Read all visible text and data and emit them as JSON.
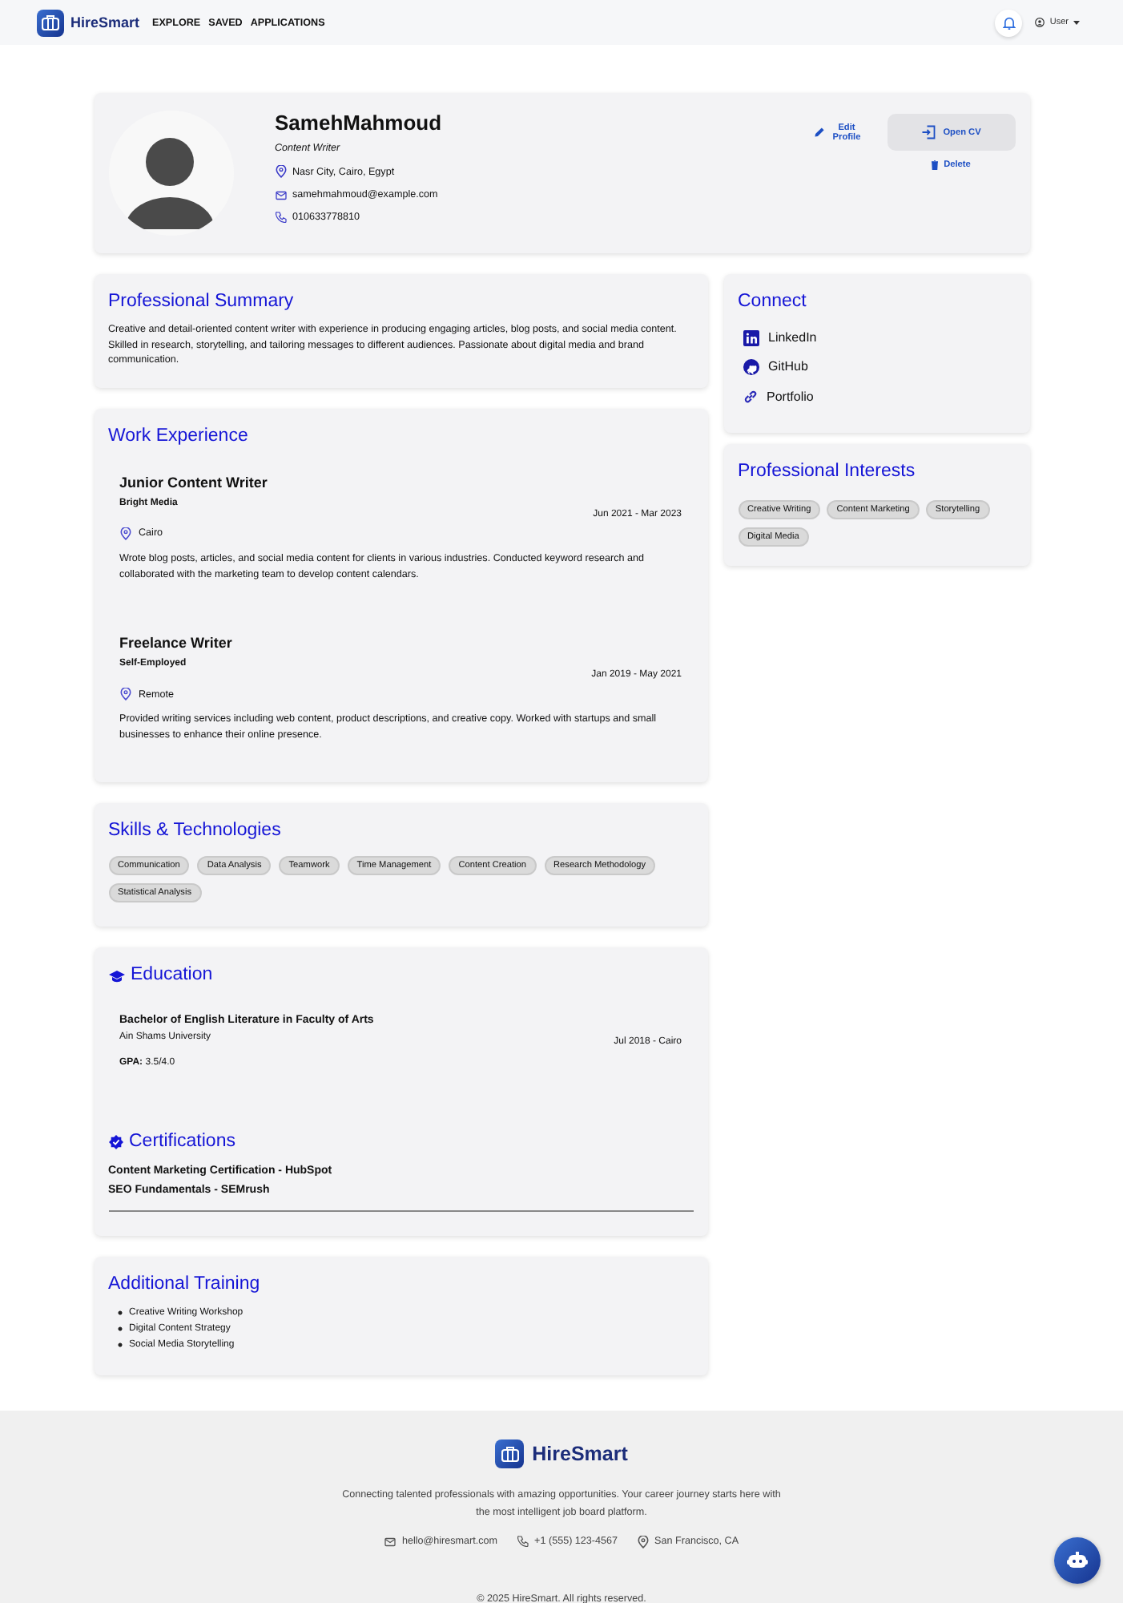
{
  "nav": {
    "brand": "HireSmart",
    "links": [
      "EXPLORE",
      "SAVED",
      "APPLICATIONS"
    ],
    "user": "User"
  },
  "profile": {
    "name": "SamehMahmoud",
    "title": "Content Writer",
    "location": "Nasr City, Cairo, Egypt",
    "email": "samehmahmoud@example.com",
    "phone": "010633778810",
    "actions": [
      {
        "label": "Edit Profile",
        "kind": "edit"
      },
      {
        "label": "Open CV",
        "kind": "open"
      },
      {
        "label": "Delete",
        "kind": "delete"
      }
    ]
  },
  "summary": {
    "title": "Professional Summary",
    "text": "Creative and detail-oriented content writer with experience in producing engaging articles, blog posts, and social media content. Skilled in research, storytelling, and tailoring messages to different audiences. Passionate about digital media and brand communication."
  },
  "experience": {
    "title": "Work Experience",
    "jobs": [
      {
        "role": "Junior Content Writer",
        "company": "Bright Media",
        "dates": "Jun 2021 - Mar 2023",
        "location": "Cairo",
        "description": "Wrote blog posts, articles, and social media content for clients in various industries. Conducted keyword research and collaborated with the marketing team to develop content calendars."
      },
      {
        "role": "Freelance Writer",
        "company": "Self-Employed",
        "dates": "Jan 2019 - May 2021",
        "location": "Remote",
        "description": "Provided writing services including web content, product descriptions, and creative copy. Worked with startups and small businesses to enhance their online presence."
      }
    ]
  },
  "skills": {
    "title": "Skills & Technologies",
    "tags": [
      "Communication",
      "Data Analysis",
      "Teamwork",
      "Time Management",
      "Content Creation",
      "Research Methodology",
      "Statistical Analysis"
    ]
  },
  "education": {
    "title": "Education",
    "entries": [
      {
        "degree": "Bachelor of English Literature in Faculty of Arts",
        "school": "Ain Shams University",
        "date": "Jul 2018 - Cairo",
        "gpa": "**GPA:** 3.5/4.0"
      }
    ]
  },
  "certifications": {
    "title": "Certifications",
    "items": [
      "Content Marketing Certification - HubSpot",
      "SEO Fundamentals - SEMrush"
    ]
  },
  "training": {
    "title": "Additional Training",
    "items": [
      "Creative Writing Workshop",
      "Digital Content Strategy",
      "Social Media Storytelling"
    ]
  },
  "connect": {
    "title": "Connect",
    "links": [
      {
        "label": "LinkedIn",
        "kind": "linkedin"
      },
      {
        "label": "GitHub",
        "kind": "github"
      },
      {
        "label": "Portfolio",
        "kind": "link"
      }
    ]
  },
  "interests": {
    "title": "Professional Interests",
    "tags": [
      "Creative Writing",
      "Content Marketing",
      "Storytelling",
      "Digital Media"
    ]
  },
  "footer": {
    "brand": "HireSmart",
    "tagline": "Connecting talented professionals with amazing opportunities. Your career journey starts here with the most intelligent job board platform.",
    "contacts": [
      {
        "kind": "email",
        "text": "hello@hiresmart.com"
      },
      {
        "kind": "phone",
        "text": "+1 (555) 123-4567"
      },
      {
        "kind": "location",
        "text": "San Francisco, CA"
      }
    ],
    "copyright": "© 2025 HireSmart. All rights reserved."
  }
}
